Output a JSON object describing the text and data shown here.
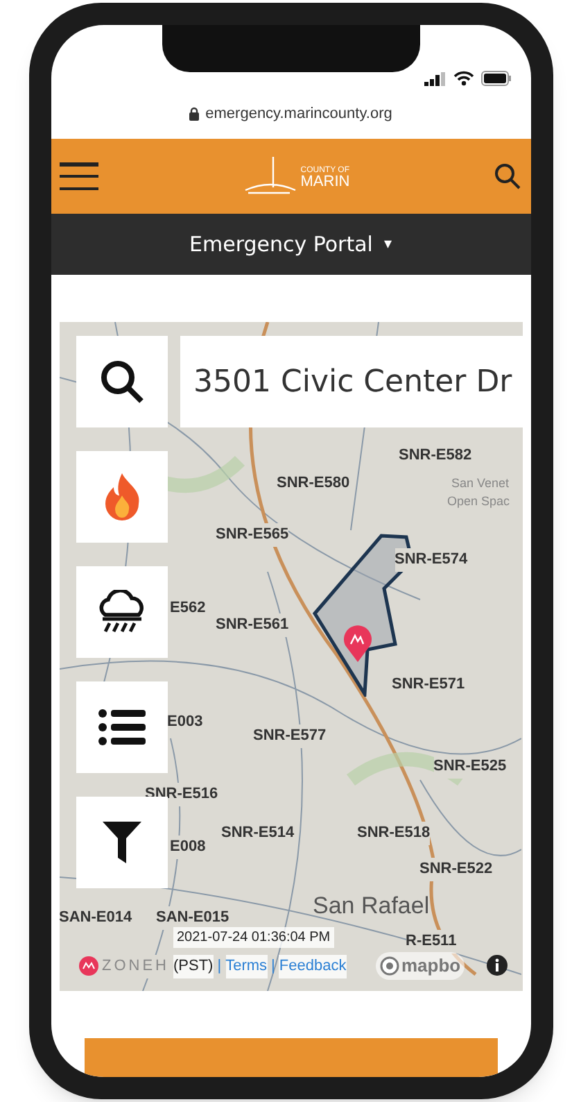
{
  "browser": {
    "url": "emergency.marincounty.org"
  },
  "header": {
    "logo_small": "COUNTY OF",
    "logo_large": "MARIN"
  },
  "nav": {
    "title": "Emergency Portal",
    "caret": "▾"
  },
  "map": {
    "search": {
      "value": "3501 Civic Center Dr"
    },
    "zones": [
      {
        "label": "SNR-E582"
      },
      {
        "label": "SNR-E580"
      },
      {
        "label": "SNR-E565"
      },
      {
        "label": "SNR-E574"
      },
      {
        "label": "E562"
      },
      {
        "label": "SNR-E561"
      },
      {
        "label": "SNR-E571"
      },
      {
        "label": "E003"
      },
      {
        "label": "SNR-E577"
      },
      {
        "label": "SNR-E525"
      },
      {
        "label": "SNR-E516"
      },
      {
        "label": "SNR-E514"
      },
      {
        "label": "SNR-E518"
      },
      {
        "label": "E008"
      },
      {
        "label": "SNR-E522"
      },
      {
        "label": "SAN-E014"
      },
      {
        "label": "SAN-E015"
      },
      {
        "label": "R-E511"
      }
    ],
    "places": [
      {
        "label": "San Rafael",
        "kind": "city"
      },
      {
        "label": "San Venet",
        "kind": "park"
      },
      {
        "label": "Open Spac",
        "kind": "park"
      }
    ],
    "timestamp": "2021-07-24 01:36:04 PM",
    "brand": "ZONEH",
    "timezone": "(PST)",
    "separator": "|",
    "links": [
      "Terms",
      "Feedback"
    ],
    "map_credit": "mapbo"
  }
}
